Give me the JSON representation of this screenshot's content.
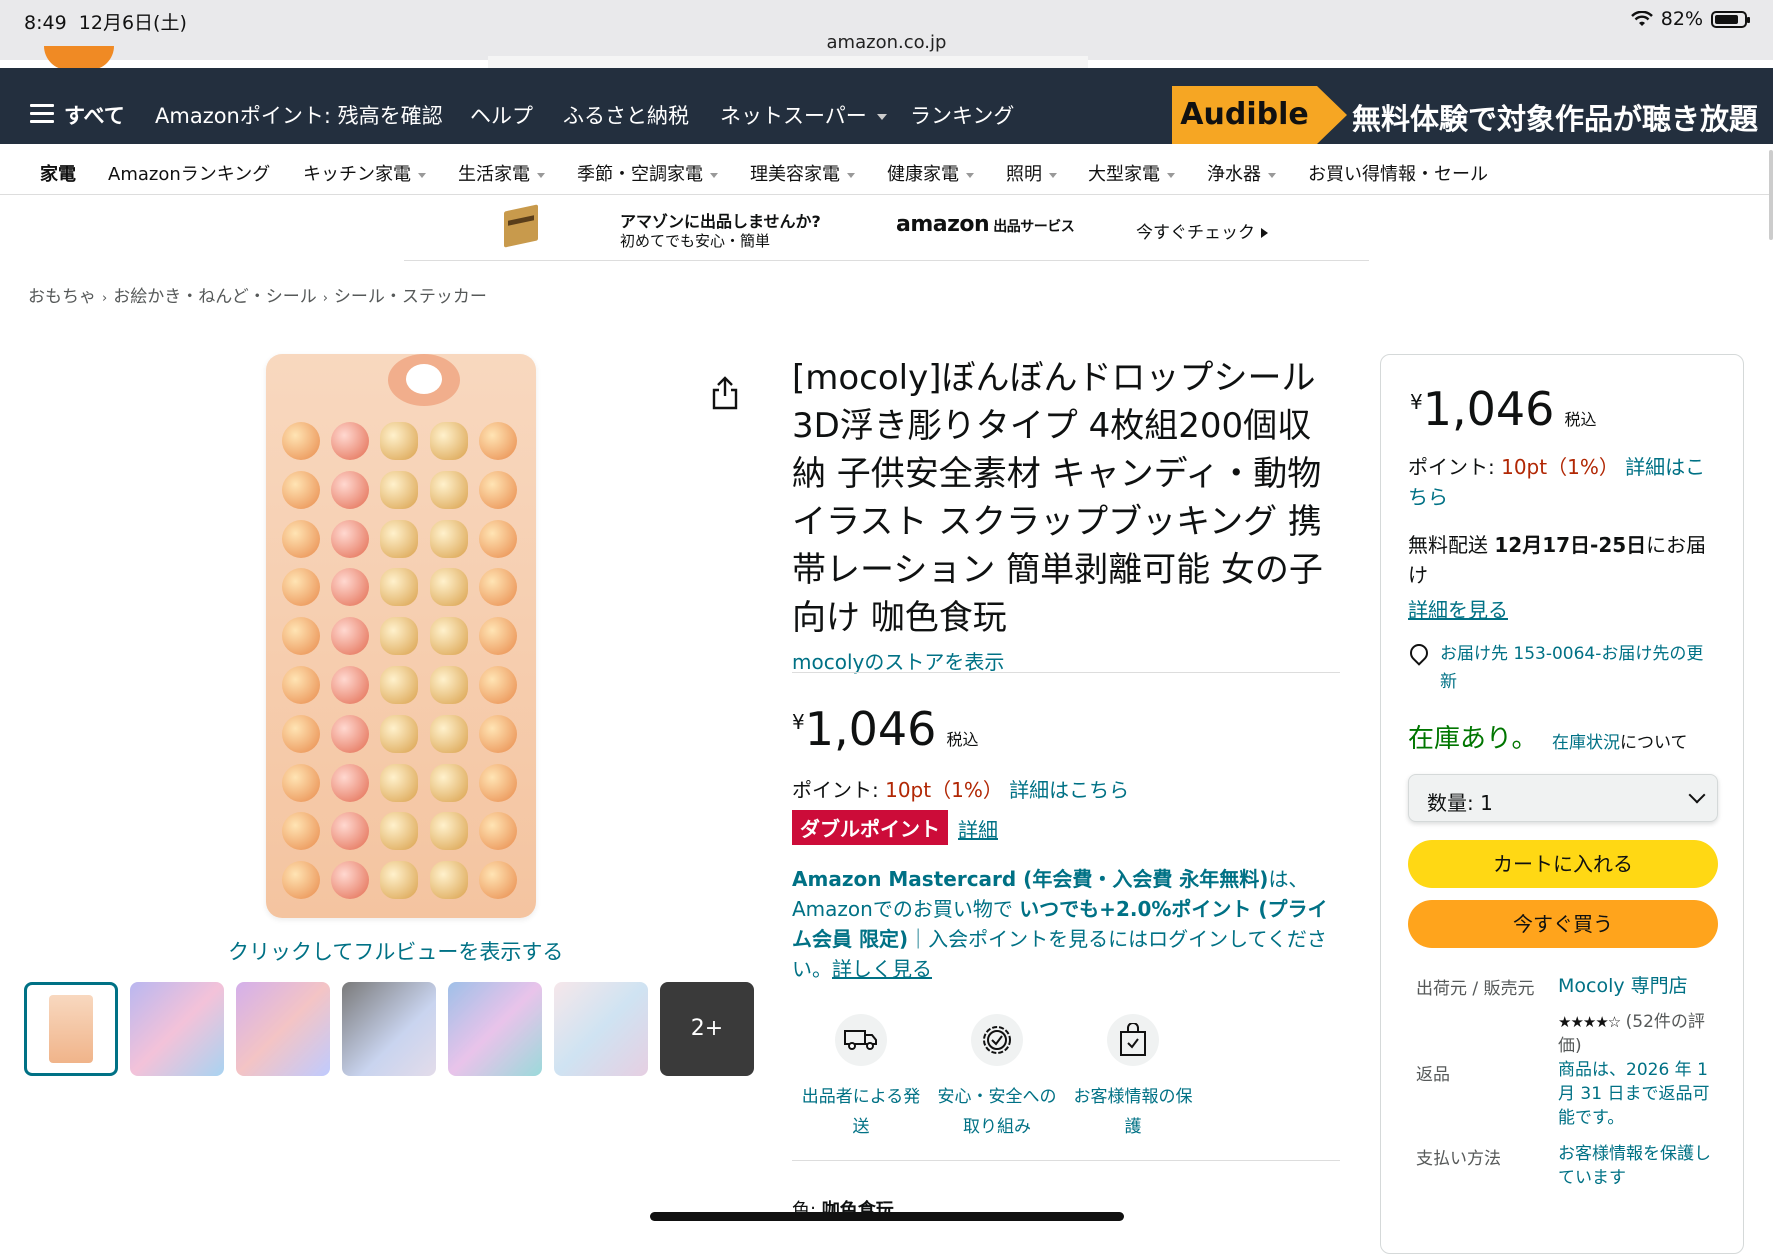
{
  "status_bar": {
    "time": "8:49",
    "date": "12月6日(土)",
    "battery": "82%",
    "battery_level": 0.82,
    "url": "amazon.co.jp"
  },
  "nav": {
    "all": "すべて",
    "items": [
      "Amazonポイント: 残高を確認",
      "ヘルプ",
      "ふるさと納税",
      "ネットスーパー",
      "ランキング"
    ],
    "audible_logo": "Audible",
    "audible_text": "無料体験で対象作品が聴き放題"
  },
  "subnav": [
    "家電",
    "Amazonランキング",
    "キッチン家電",
    "生活家電",
    "季節・空調家電",
    "理美容家電",
    "健康家電",
    "照明",
    "大型家電",
    "浄水器",
    "お買い得情報・セール"
  ],
  "banner": {
    "line1": "アマゾンに出品しませんか?",
    "line2": "初めてでも安心・簡単",
    "logo": "amazon",
    "logo_sub": "出品サービス",
    "cta": "今すぐチェック"
  },
  "breadcrumb": [
    "おもちゃ",
    "お絵かき・ねんど・シール",
    "シール・ステッカー"
  ],
  "gallery": {
    "fullview": "クリックしてフルビューを表示する",
    "more": "2+"
  },
  "product": {
    "title": "[mocoly]ぼんぼんドロップシール 3D浮き彫りタイプ 4枚組200個収納 子供安全素材 キャンディ・動物イラスト スクラップブッキング 携帯レーション 簡単剥離可能 女の子向け 咖色食玩",
    "store": "mocolyのストアを表示",
    "yen": "¥",
    "price": "1,046",
    "tax": "税込",
    "points_label": "ポイント:",
    "points_value": "10pt（1%）",
    "points_link": "詳細はこちら",
    "double_badge": "ダブルポイント",
    "double_link": "詳細",
    "mc_1": "Amazon Mastercard (年会費・入会費 永年無料)",
    "mc_2": "は、Amazonでのお買い物で ",
    "mc_3": "いつでも+2.0%ポイント (プライム会員 限定)",
    "mc_4": "｜入会ポイントを見るにはログインしてください。",
    "mc_link": "詳しく見る",
    "features": [
      "出品者による発送",
      "安心・安全への取り組み",
      "お客様情報の保護"
    ],
    "color_label": "色: ",
    "color_value": "咖色食玩"
  },
  "buybox": {
    "yen": "¥",
    "price": "1,046",
    "tax": "税込",
    "points_label": "ポイント: ",
    "points_value": "10pt（1%）",
    "points_link": "詳細はこちら",
    "delivery_1": "無料配送 ",
    "delivery_date": "12月17日-25日",
    "delivery_2": "にお届け",
    "detail_link": "詳細を見る",
    "location": "お届け先 153-0064-お届け先の更新",
    "stock": "在庫あり。",
    "stock_link": "在庫状況",
    "stock_note": "について",
    "qty": "数量: 1",
    "cart": "カートに入れる",
    "buy": "今すぐ買う",
    "seller_label": "出荷元 / 販売元",
    "seller": "Mocoly 専門店",
    "rating_stars": "★★★★☆",
    "rating_text": "(52件の評価)",
    "return_label": "返品",
    "return_text": "商品は、2026 年 1 月 31 日まで返品可能です。",
    "pay_label": "支払い方法",
    "pay_text": "お客様情報を保護しています"
  }
}
